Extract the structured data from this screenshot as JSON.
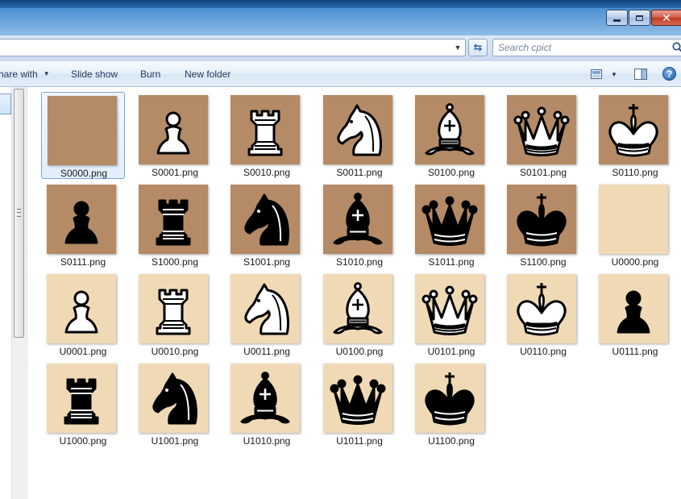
{
  "window": {
    "minimize_icon": "minimize-icon",
    "maximize_icon": "maximize-icon",
    "close_icon": "close-icon"
  },
  "search": {
    "placeholder": "Search cpict"
  },
  "toolbar": {
    "share_label": "hare with",
    "slideshow_label": "Slide show",
    "burn_label": "Burn",
    "new_folder_label": "New folder"
  },
  "colors": {
    "dark_square": "#b48b66",
    "light_square": "#f0dab5"
  },
  "files": [
    {
      "name": "S0000.png",
      "piece": "none",
      "side": "white",
      "bg": "dark"
    },
    {
      "name": "S0001.png",
      "piece": "pawn",
      "side": "white",
      "bg": "dark"
    },
    {
      "name": "S0010.png",
      "piece": "rook",
      "side": "white",
      "bg": "dark"
    },
    {
      "name": "S0011.png",
      "piece": "knight",
      "side": "white",
      "bg": "dark"
    },
    {
      "name": "S0100.png",
      "piece": "bishop",
      "side": "white",
      "bg": "dark"
    },
    {
      "name": "S0101.png",
      "piece": "queen",
      "side": "white",
      "bg": "dark"
    },
    {
      "name": "S0110.png",
      "piece": "king",
      "side": "white",
      "bg": "dark"
    },
    {
      "name": "S0111.png",
      "piece": "pawn",
      "side": "black",
      "bg": "dark"
    },
    {
      "name": "S1000.png",
      "piece": "rook",
      "side": "black",
      "bg": "dark"
    },
    {
      "name": "S1001.png",
      "piece": "knight",
      "side": "black",
      "bg": "dark"
    },
    {
      "name": "S1010.png",
      "piece": "bishop",
      "side": "black",
      "bg": "dark"
    },
    {
      "name": "S1011.png",
      "piece": "queen",
      "side": "black",
      "bg": "dark"
    },
    {
      "name": "S1100.png",
      "piece": "king",
      "side": "black",
      "bg": "dark"
    },
    {
      "name": "U0000.png",
      "piece": "none",
      "side": "white",
      "bg": "light"
    },
    {
      "name": "U0001.png",
      "piece": "pawn",
      "side": "white",
      "bg": "light"
    },
    {
      "name": "U0010.png",
      "piece": "rook",
      "side": "white",
      "bg": "light"
    },
    {
      "name": "U0011.png",
      "piece": "knight",
      "side": "white",
      "bg": "light"
    },
    {
      "name": "U0100.png",
      "piece": "bishop",
      "side": "white",
      "bg": "light"
    },
    {
      "name": "U0101.png",
      "piece": "queen",
      "side": "white",
      "bg": "light"
    },
    {
      "name": "U0110.png",
      "piece": "king",
      "side": "white",
      "bg": "light"
    },
    {
      "name": "U0111.png",
      "piece": "pawn",
      "side": "black",
      "bg": "light"
    },
    {
      "name": "U1000.png",
      "piece": "rook",
      "side": "black",
      "bg": "light"
    },
    {
      "name": "U1001.png",
      "piece": "knight",
      "side": "black",
      "bg": "light"
    },
    {
      "name": "U1010.png",
      "piece": "bishop",
      "side": "black",
      "bg": "light"
    },
    {
      "name": "U1011.png",
      "piece": "queen",
      "side": "black",
      "bg": "light"
    },
    {
      "name": "U1100.png",
      "piece": "king",
      "side": "black",
      "bg": "light"
    }
  ]
}
